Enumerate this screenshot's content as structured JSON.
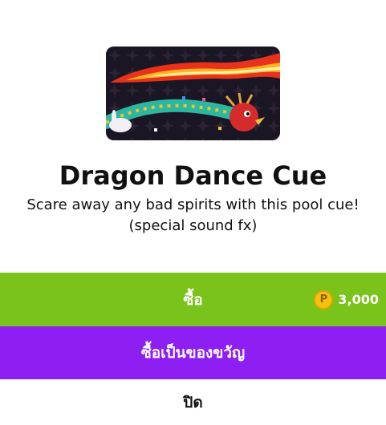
{
  "item": {
    "title": "Dragon Dance Cue",
    "description_line1": "Scare away any bad spirits with this pool cue!",
    "description_line2": "(special sound fx)"
  },
  "buy": {
    "label": "ซื้อ",
    "price": "3,000",
    "coin_symbol": "P",
    "color": "#79c31a"
  },
  "gift": {
    "label": "ซื้อเป็นของขวัญ",
    "color": "#8e1ff2"
  },
  "close": {
    "label": "ปิด"
  },
  "icons": {
    "coin": "coin-icon",
    "artwork": "dragon-cue-image"
  }
}
